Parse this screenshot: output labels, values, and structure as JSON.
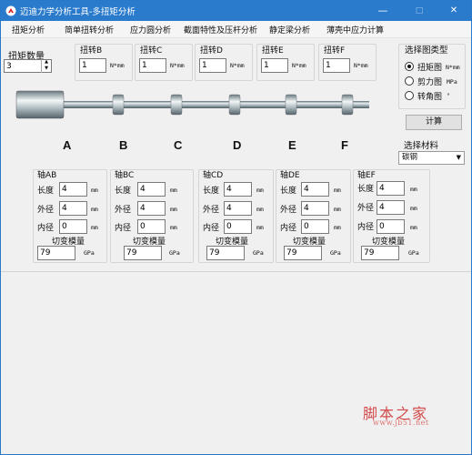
{
  "titlebar": {
    "title": "迈迪力学分析工具-多扭矩分析",
    "minimize": "—",
    "maximize": "□",
    "close": "✕"
  },
  "menu": [
    "扭矩分析",
    "简单扭转分析",
    "应力圆分析",
    "截面特性及压杆分析",
    "静定梁分析",
    "薄壳中应力计算"
  ],
  "torque_count": {
    "label": "扭矩数量",
    "value": "3"
  },
  "torques": [
    {
      "label": "扭转B",
      "value": "1",
      "unit": "N*mm"
    },
    {
      "label": "扭转C",
      "value": "1",
      "unit": "N*mm"
    },
    {
      "label": "扭转D",
      "value": "1",
      "unit": "N*mm"
    },
    {
      "label": "扭转E",
      "value": "1",
      "unit": "N*mm"
    },
    {
      "label": "扭转F",
      "value": "1",
      "unit": "N*mm"
    }
  ],
  "chart_type": {
    "label": "选择图类型",
    "options": [
      {
        "label": "扭矩图",
        "unit": "N*mm",
        "selected": true
      },
      {
        "label": "剪力图",
        "unit": "MPa",
        "selected": false
      },
      {
        "label": "转角图",
        "unit": "°",
        "selected": false
      }
    ]
  },
  "calc_button": "计算",
  "material": {
    "label": "选择材料",
    "value": "碳钢"
  },
  "letters": [
    "A",
    "B",
    "C",
    "D",
    "E",
    "F"
  ],
  "shafts": [
    {
      "title": "轴AB",
      "length": "4",
      "outer": "4",
      "inner": "0",
      "shear": "79"
    },
    {
      "title": "轴BC",
      "length": "4",
      "outer": "4",
      "inner": "0",
      "shear": "79"
    },
    {
      "title": "轴CD",
      "length": "4",
      "outer": "4",
      "inner": "0",
      "shear": "79"
    },
    {
      "title": "轴DE",
      "length": "4",
      "outer": "4",
      "inner": "0",
      "shear": "79"
    },
    {
      "title": "轴EF",
      "length": "4",
      "outer": "4",
      "inner": "0",
      "shear": "79"
    }
  ],
  "shaft_labels": {
    "length": "长度",
    "outer": "外径",
    "inner": "内径",
    "shear": "切变模量",
    "mm": "mm",
    "gpa": "GPa"
  },
  "watermark": {
    "brand": "脚本之家",
    "url": "www.jb51.net"
  }
}
